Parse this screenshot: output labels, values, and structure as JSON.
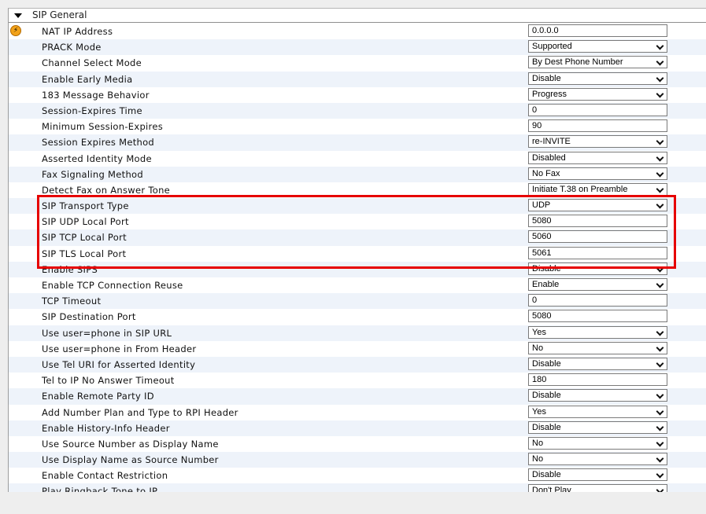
{
  "section": {
    "title": "SIP General"
  },
  "colors": {
    "highlight": "#e60000",
    "alt_row": "#eef3fa",
    "warning": "#f2a21a"
  },
  "icons": {
    "warning": "⚡"
  },
  "rows": [
    {
      "label": "NAT IP Address",
      "type": "input",
      "value": "0.0.0.0"
    },
    {
      "label": "PRACK Mode",
      "type": "select",
      "value": "Supported"
    },
    {
      "label": "Channel Select Mode",
      "type": "select",
      "value": "By Dest Phone Number"
    },
    {
      "label": "Enable Early Media",
      "type": "select",
      "value": "Disable"
    },
    {
      "label": "183 Message Behavior",
      "type": "select",
      "value": "Progress"
    },
    {
      "label": "Session-Expires Time",
      "type": "input",
      "value": "0"
    },
    {
      "label": "Minimum Session-Expires",
      "type": "input",
      "value": "90"
    },
    {
      "label": "Session Expires Method",
      "type": "select",
      "value": "re-INVITE"
    },
    {
      "label": "Asserted Identity Mode",
      "type": "select",
      "value": "Disabled"
    },
    {
      "label": "Fax Signaling Method",
      "type": "select",
      "value": "No Fax"
    },
    {
      "label": "Detect Fax on Answer Tone",
      "type": "select",
      "value": "Initiate T.38 on Preamble"
    },
    {
      "label": "SIP Transport Type",
      "type": "select",
      "value": "UDP"
    },
    {
      "label": "SIP UDP Local Port",
      "type": "input",
      "value": "5080"
    },
    {
      "label": "SIP TCP Local Port",
      "type": "input",
      "value": "5060"
    },
    {
      "label": "SIP TLS Local Port",
      "type": "input",
      "value": "5061"
    },
    {
      "label": "Enable SIPS",
      "type": "select",
      "value": "Disable"
    },
    {
      "label": "Enable TCP Connection Reuse",
      "type": "select",
      "value": "Enable"
    },
    {
      "label": "TCP Timeout",
      "type": "input",
      "value": "0"
    },
    {
      "label": "SIP Destination Port",
      "type": "input",
      "value": "5080"
    },
    {
      "label": "Use user=phone in SIP URL",
      "type": "select",
      "value": "Yes"
    },
    {
      "label": "Use user=phone in From Header",
      "type": "select",
      "value": "No"
    },
    {
      "label": "Use Tel URI for Asserted Identity",
      "type": "select",
      "value": "Disable"
    },
    {
      "label": "Tel to IP No Answer Timeout",
      "type": "input",
      "value": "180"
    },
    {
      "label": "Enable Remote Party ID",
      "type": "select",
      "value": "Disable"
    },
    {
      "label": "Add Number Plan and Type to RPI Header",
      "type": "select",
      "value": "Yes"
    },
    {
      "label": "Enable History-Info Header",
      "type": "select",
      "value": "Disable"
    },
    {
      "label": "Use Source Number as Display Name",
      "type": "select",
      "value": "No"
    },
    {
      "label": "Use Display Name as Source Number",
      "type": "select",
      "value": "No"
    },
    {
      "label": "Enable Contact Restriction",
      "type": "select",
      "value": "Disable"
    },
    {
      "label": "Play Ringback Tone to IP",
      "type": "select",
      "value": "Don't Play"
    }
  ]
}
